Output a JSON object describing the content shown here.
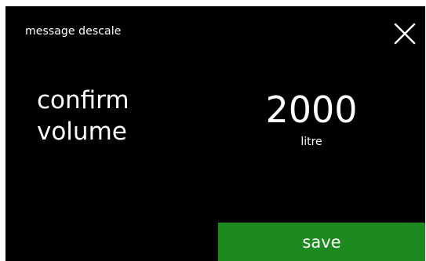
{
  "header": {
    "title": "message descale",
    "close_icon": "close-icon"
  },
  "prompt": {
    "line1": "confirm",
    "line2": "volume"
  },
  "volume": {
    "value": "2000",
    "unit": "litre"
  },
  "actions": {
    "save_label": "save"
  },
  "colors": {
    "background": "#000000",
    "text": "#ffffff",
    "save_button": "#1c8a1f"
  }
}
